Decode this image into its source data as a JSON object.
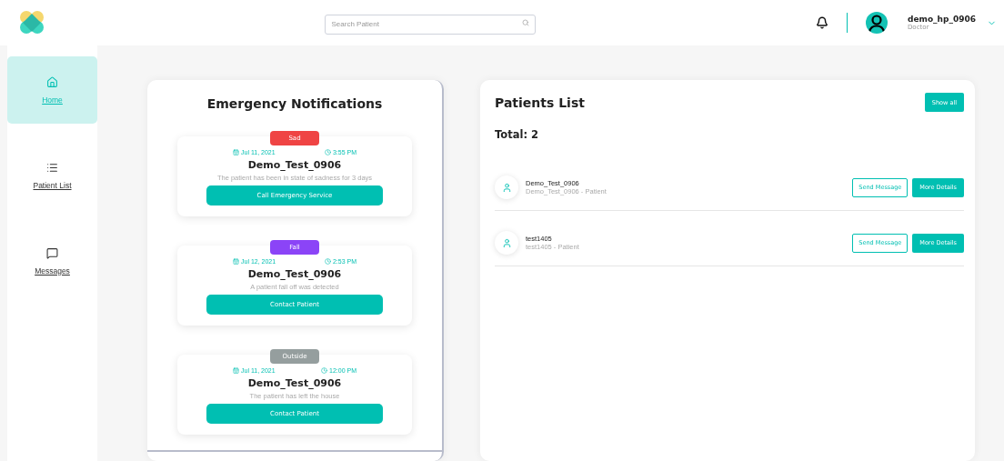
{
  "header": {
    "search": {
      "placeholder": "Search Patient"
    },
    "user": {
      "name": "demo_hp_0906",
      "role": "Doctor"
    }
  },
  "sidebar": {
    "items": [
      {
        "label": "Home",
        "kind": "home",
        "selected": true
      },
      {
        "label": "Patient List",
        "kind": "list",
        "selected": false
      },
      {
        "label": "Messages",
        "kind": "messages",
        "selected": false
      }
    ]
  },
  "notifications": {
    "title": "Emergency Notifications",
    "items": [
      {
        "tag": "Sad",
        "color": "#ef4444",
        "date": "Jul 11, 2021",
        "time": "3:55 PM",
        "patient": "Demo_Test_0906",
        "message": "The patient has been in state of sadness for 3 days",
        "action": "Call Emergency Service"
      },
      {
        "tag": "Fall",
        "color": "#8b44f7",
        "date": "Jul 12, 2021",
        "time": "2:53 PM",
        "patient": "Demo_Test_0906",
        "message": "A patient fall off was detected",
        "action": "Contact Patient"
      },
      {
        "tag": "Outside",
        "color": "#959e9e",
        "date": "Jul 11, 2021",
        "time": "12:00 PM",
        "patient": "Demo_Test_0906",
        "message": "The patient has left the house",
        "action": "Contact Patient"
      }
    ]
  },
  "patients": {
    "title": "Patients List",
    "show_all": "Show all",
    "total": "Total: 2",
    "rows": [
      {
        "name": "Demo_Test_0906",
        "subtitle": "Demo_Test_0906 - Patient",
        "send": "Send Message",
        "details": "More Details"
      },
      {
        "name": "test1405",
        "subtitle": "test1405 - Patient",
        "send": "Send Message",
        "details": "More Details"
      }
    ]
  }
}
